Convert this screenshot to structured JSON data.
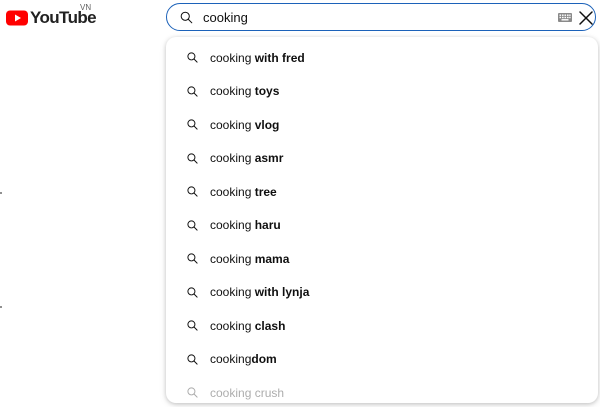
{
  "logo": {
    "text": "YouTube",
    "region": "VN",
    "brand_color": "#ff0000"
  },
  "search": {
    "value": "cooking",
    "icon": "search-icon",
    "keyboard_icon": "keyboard-icon",
    "clear_icon": "close-icon",
    "border_color": "#1c62b9"
  },
  "suggestions": [
    {
      "typed": "cooking",
      "completion": " with fred"
    },
    {
      "typed": "cooking",
      "completion": " toys"
    },
    {
      "typed": "cooking",
      "completion": " vlog"
    },
    {
      "typed": "cooking",
      "completion": " asmr"
    },
    {
      "typed": "cooking",
      "completion": " tree"
    },
    {
      "typed": "cooking",
      "completion": " haru"
    },
    {
      "typed": "cooking",
      "completion": " mama"
    },
    {
      "typed": "cooking",
      "completion": " with lynja"
    },
    {
      "typed": "cooking",
      "completion": " clash"
    },
    {
      "typed": "cooking",
      "completion": "dom"
    },
    {
      "typed": "cooking",
      "completion": " crush"
    }
  ]
}
